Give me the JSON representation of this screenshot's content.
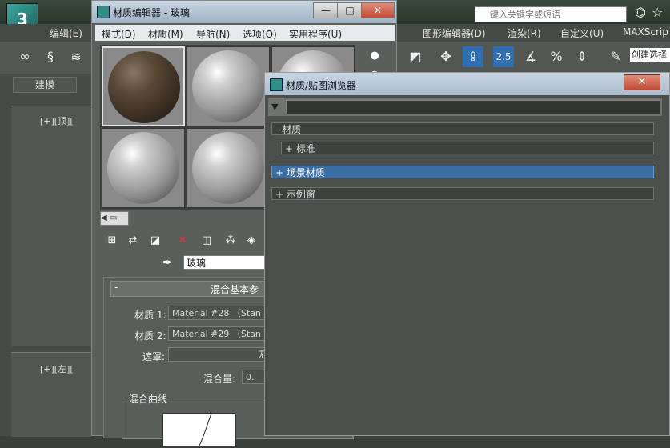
{
  "app": {
    "menu": [
      "编辑(E)",
      "图形编辑器(D)",
      "渲染(R)",
      "自定义(U)",
      "MAXScrip"
    ],
    "search_placeholder": "键入关键字或短语",
    "create_selection": "创建选择",
    "ribbon_tab": "建模",
    "viewport_top_label": "[+][顶][",
    "viewport_left_label": "[+][左][",
    "toolbar_readout": "2.5"
  },
  "material_editor": {
    "title": "材质编辑器 - 玻璃",
    "menu": [
      "模式(D)",
      "材质(M)",
      "导航(N)",
      "选项(O)",
      "实用程序(U)"
    ],
    "material_name": "玻璃",
    "rollout_title": "混合基本参",
    "material1_label": "材质 1:",
    "material1_value": "Material #28 （Stan",
    "material2_label": "材质 2:",
    "material2_value": "Material #29 （Stan",
    "mask_label": "遮罩:",
    "mask_value": "无",
    "mix_amount_label": "混合量:",
    "mix_amount_value": "0.",
    "mix_curve_label": "混合曲线"
  },
  "browser": {
    "title": "材质/贴图浏览器",
    "rows": [
      {
        "label": "- 材质"
      },
      {
        "label": "+ 标准"
      },
      {
        "label": "+ 场景材质"
      },
      {
        "label": "+ 示例窗"
      }
    ]
  },
  "colors": {
    "selected_row": "#3a6ea5",
    "title_bar": "#b4c5d6"
  }
}
